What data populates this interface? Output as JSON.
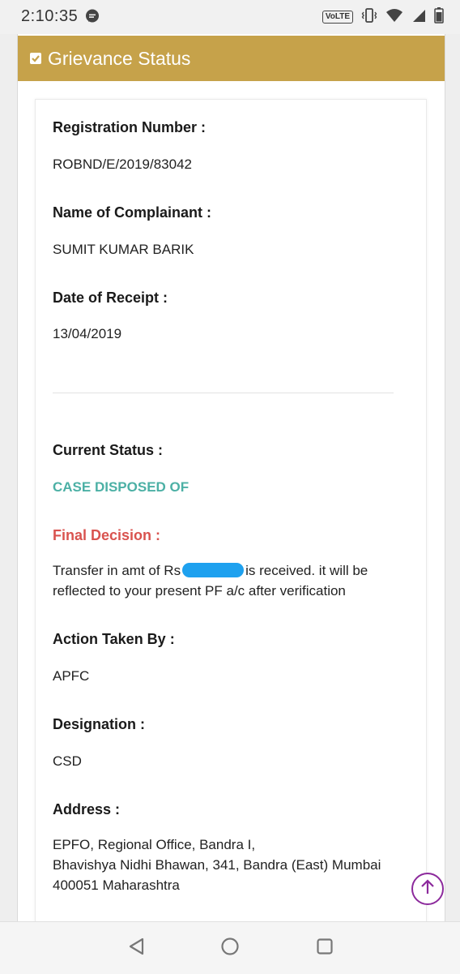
{
  "status_bar": {
    "time": "2:10:35",
    "volte": "VoLTE"
  },
  "header": {
    "title": "Grievance Status"
  },
  "details": {
    "registration_label": "Registration Number :",
    "registration_value": "ROBND/E/2019/83042",
    "complainant_label": "Name of Complainant :",
    "complainant_value": "SUMIT KUMAR BARIK",
    "receipt_label": "Date of Receipt :",
    "receipt_value": "13/04/2019",
    "current_status_label": "Current Status :",
    "current_status_value": "CASE DISPOSED OF",
    "final_decision_label": "Final Decision :",
    "final_decision_text_1": "Transfer in amt of Rs",
    "final_decision_text_2": "is received. it will be reflected to your present PF a/c after verification",
    "action_taken_label": "Action Taken By :",
    "action_taken_value": "APFC",
    "designation_label": "Designation :",
    "designation_value": "CSD",
    "address_label": "Address :",
    "address_line_1": "EPFO, Regional Office, Bandra I,",
    "address_line_2": "Bhavishya Nidhi Bhawan, 341, Bandra (East) Mumbai 400051 Maharashtra"
  },
  "colors": {
    "header_bg": "#c6a24a",
    "status_green": "#4cb0a5",
    "decision_red": "#d9534f",
    "scroll_button": "#8c2a9c",
    "redaction": "#1ea1ef"
  },
  "icons": {
    "notification": "chat-bubble-icon",
    "vibrate": "vibrate-icon",
    "wifi": "wifi-icon",
    "signal": "signal-icon",
    "battery": "battery-icon",
    "header_check": "checkbox-checked-icon",
    "scroll_top": "arrow-up-circle-icon",
    "nav_back": "back-triangle-icon",
    "nav_home": "home-circle-icon",
    "nav_recents": "recents-square-icon"
  }
}
